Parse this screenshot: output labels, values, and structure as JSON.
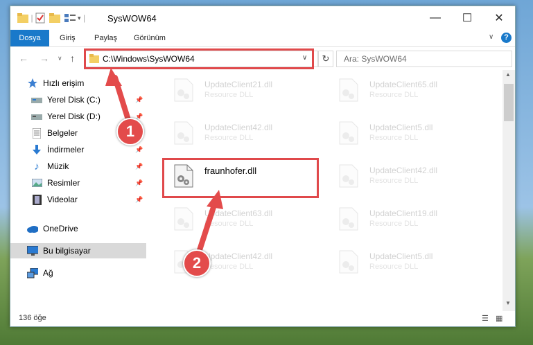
{
  "window": {
    "title": "SysWOW64"
  },
  "ribbon": {
    "tabs": [
      "Dosya",
      "Giriş",
      "Paylaş",
      "Görünüm"
    ]
  },
  "address": {
    "path": "C:\\Windows\\SysWOW64"
  },
  "search": {
    "placeholder": "Ara: SysWOW64"
  },
  "sidebar": {
    "items": [
      {
        "label": "Hızlı erişim",
        "icon": "star-icon"
      },
      {
        "label": "Yerel Disk (C:)",
        "icon": "drive-icon"
      },
      {
        "label": "Yerel Disk (D:)",
        "icon": "drive-icon"
      },
      {
        "label": "Belgeler",
        "icon": "document-icon"
      },
      {
        "label": "İndirmeler",
        "icon": "download-icon"
      },
      {
        "label": "Müzik",
        "icon": "music-icon"
      },
      {
        "label": "Resimler",
        "icon": "pictures-icon"
      },
      {
        "label": "Videolar",
        "icon": "video-icon"
      },
      {
        "label": "OneDrive",
        "icon": "cloud-icon"
      },
      {
        "label": "Bu bilgisayar",
        "icon": "computer-icon"
      },
      {
        "label": "Ağ",
        "icon": "network-icon"
      }
    ]
  },
  "files": [
    {
      "name": "UpdateClient21.dll",
      "desc": "Resource DLL"
    },
    {
      "name": "UpdateClient65.dll",
      "desc": "Resource DLL"
    },
    {
      "name": "UpdateClient42.dll",
      "desc": "Resource DLL"
    },
    {
      "name": "UpdateClient5.dll",
      "desc": "Resource DLL"
    },
    {
      "name": "fraunhofer.dll",
      "desc": ""
    },
    {
      "name": "UpdateClient42.dll",
      "desc": "Resource DLL"
    },
    {
      "name": "UpdateClient63.dll",
      "desc": "Resource DLL"
    },
    {
      "name": "UpdateClient19.dll",
      "desc": "Resource DLL"
    },
    {
      "name": "UpdateClient42.dll",
      "desc": "Resource DLL"
    },
    {
      "name": "UpdateClient5.dll",
      "desc": "Resource DLL"
    }
  ],
  "status": {
    "count": "136 öğe"
  },
  "annotations": {
    "step1": "1",
    "step2": "2"
  },
  "colors": {
    "accent": "#1979ca",
    "highlight": "#e0494b"
  }
}
